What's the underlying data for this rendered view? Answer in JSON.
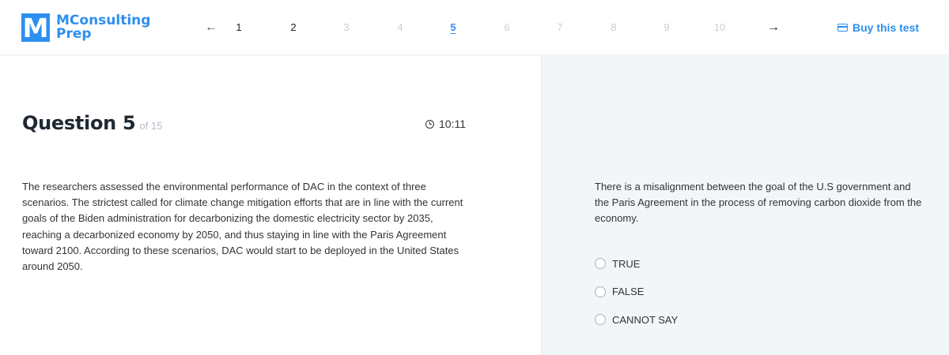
{
  "brand": {
    "logo_letter": "M",
    "name_line1": "MConsulting",
    "name_line2": "Prep"
  },
  "pager": {
    "prev_icon": "arrow-left-icon",
    "next_icon": "arrow-right-icon",
    "prev_glyph": "←",
    "next_glyph": "→",
    "pages": [
      "1",
      "2",
      "3",
      "4",
      "5",
      "6",
      "7",
      "8",
      "9",
      "10"
    ],
    "current": "5",
    "accent_color": "#2d8ff0"
  },
  "buy": {
    "label": "Buy this test",
    "icon": "credit-card-icon"
  },
  "question": {
    "title": "Question 5",
    "of_total": "of 15",
    "timer_icon": "clock-icon",
    "timer": "10:11",
    "passage": "The researchers assessed the environmental performance of DAC in the context of three scenarios. The strictest called for climate change mitigation efforts that are in line with the current goals of the Biden administration for decarbonizing the domestic electricity sector by 2035, reaching a decarbonized economy by 2050, and thus staying in line with the Paris Agreement toward 2100. According to these scenarios, DAC would start to be deployed in the United States around 2050."
  },
  "answer": {
    "statement": "There is a misalignment between the goal of the U.S government and the Paris Agreement in the process of removing carbon dioxide from the economy.",
    "options": [
      "TRUE",
      "FALSE",
      "CANNOT SAY"
    ]
  }
}
